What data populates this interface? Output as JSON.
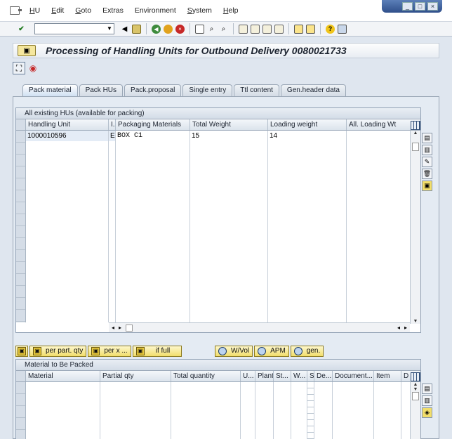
{
  "menu": {
    "items": [
      {
        "label": "HU",
        "u": "H",
        "rest": "U"
      },
      {
        "label": "Edit",
        "u": "E",
        "rest": "dit"
      },
      {
        "label": "Goto",
        "u": "G",
        "rest": "oto"
      },
      {
        "label": "Extras",
        "u": "",
        "rest": "Extras"
      },
      {
        "label": "Environment",
        "u": "",
        "rest": "Environment"
      },
      {
        "label": "System",
        "u": "S",
        "rest": "ystem"
      },
      {
        "label": "Help",
        "u": "H",
        "rest": "elp"
      }
    ]
  },
  "toolbar": {
    "command_value": ""
  },
  "title": "Processing of Handling Units for Outbound Delivery 0080021733",
  "tabs": [
    {
      "label": "Pack material",
      "active": true
    },
    {
      "label": "Pack HUs"
    },
    {
      "label": "Pack.proposal"
    },
    {
      "label": "Single entry"
    },
    {
      "label": "Ttl content"
    },
    {
      "label": "Gen.header data"
    }
  ],
  "hu_table": {
    "title": "All existing HUs (available for packing)",
    "columns": [
      "Handling Unit",
      "I.",
      "Packaging Materials",
      "Total Weight",
      "Loading weight",
      "All. Loading Wt"
    ],
    "rows": [
      [
        "1000010596",
        "E",
        "BOX C1",
        "15",
        "14",
        ""
      ]
    ]
  },
  "buttons": {
    "per_part_qty": "per part. qty",
    "per_x": "per x ...",
    "if_full": "if full",
    "w_vol": "W/Vol",
    "apm": "APM",
    "gen": "gen."
  },
  "material_table": {
    "title": "Material to Be Packed",
    "columns": [
      "Material",
      "Partial qty",
      "Total quantity",
      "U...",
      "Plant",
      "St...",
      "W...",
      "S",
      "De...",
      "Document...",
      "Item",
      "D"
    ]
  },
  "colors": {
    "accent": "#f2de6a",
    "panel": "#e4ebf3"
  }
}
